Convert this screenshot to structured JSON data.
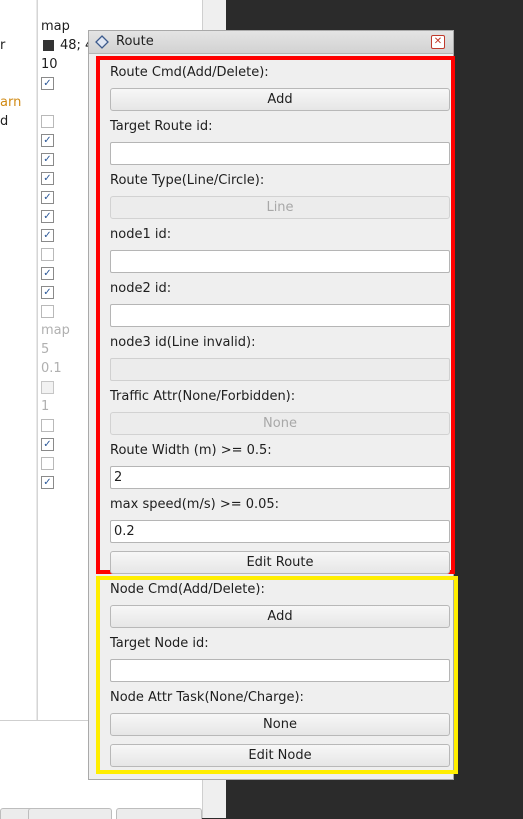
{
  "background": {
    "col1_texts": [
      "r",
      "arn",
      "d"
    ],
    "col2_texts": [
      "map",
      "48; 4",
      "10",
      "map",
      "5",
      "0.1",
      "1"
    ],
    "accent_orange": "#d08a14"
  },
  "dialog": {
    "title": "Route",
    "close_glyph": "✕",
    "route_section": {
      "route_cmd_label": "Route Cmd(Add/Delete):",
      "route_cmd_button": "Add",
      "target_route_label": "Target Route id:",
      "target_route_value": "",
      "route_type_label": "Route Type(Line/Circle):",
      "route_type_button": "Line",
      "node1_label": "node1 id:",
      "node1_value": "",
      "node2_label": "node2 id:",
      "node2_value": "",
      "node3_label": "node3 id(Line invalid):",
      "node3_value": "",
      "traffic_label": "Traffic Attr(None/Forbidden):",
      "traffic_button": "None",
      "width_label": "Route Width (m) >= 0.5:",
      "width_value": "2",
      "speed_label": "max speed(m/s) >= 0.05:",
      "speed_value": "0.2",
      "edit_route_button": "Edit Route"
    },
    "node_section": {
      "node_cmd_label": "Node Cmd(Add/Delete):",
      "node_cmd_button": "Add",
      "target_node_label": "Target Node id:",
      "target_node_value": "",
      "node_attr_label": "Node Attr Task(None/Charge):",
      "node_attr_button": "None",
      "edit_node_button": "Edit Node"
    },
    "highlight_colors": {
      "route": "#ff0000",
      "node": "#ffee00"
    }
  }
}
